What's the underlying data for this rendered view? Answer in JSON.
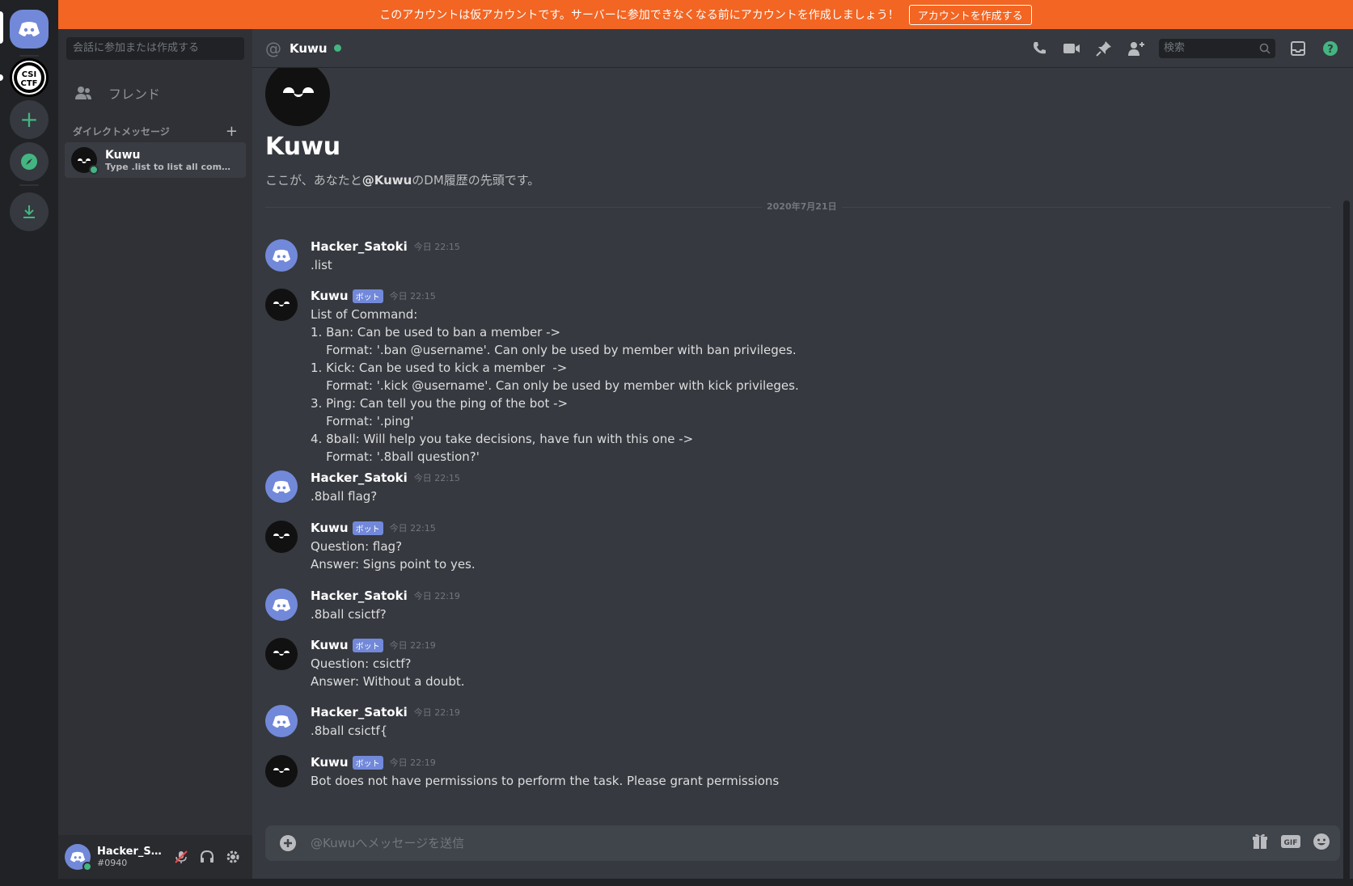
{
  "notice": {
    "text": "このアカウントは仮アカウントです。サーバーに参加できなくなる前にアカウントを作成しましょう！",
    "button": "アカウントを作成する"
  },
  "sidebar": {
    "search_placeholder": "会話に参加または作成する",
    "friends_label": "フレンド",
    "dm_header": "ダイレクトメッセージ",
    "dm_items": [
      {
        "name": "Kuwu",
        "sub": "Type .list to list all command..."
      }
    ],
    "user": {
      "name": "Hacker_Sat...",
      "tag": "#0940"
    }
  },
  "chat": {
    "channel_name": "Kuwu",
    "search_placeholder": "検索",
    "intro_title": "Kuwu",
    "intro_sub_pre": "ここが、あなたと",
    "intro_sub_mention": "@Kuwu",
    "intro_sub_post": "のDM履歴の先頭です。",
    "date_divider": "2020年7月21日",
    "input_placeholder": "@Kuwuへメッセージを送信",
    "bot_tag": "ボット",
    "messages": [
      {
        "author": "Hacker_Satoki",
        "time": "今日 22:15",
        "bot": false,
        "text": ".list"
      },
      {
        "author": "Kuwu",
        "time": "今日 22:15",
        "bot": true,
        "text": "List of Command:\n1. Ban: Can be used to ban a member ->\n    Format: '.ban @username'. Can only be used by member with ban privileges.\n1. Kick: Can be used to kick a member  ->\n    Format: '.kick @username'. Can only be used by member with kick privileges.\n3. Ping: Can tell you the ping of the bot ->\n    Format: '.ping'\n4. 8ball: Will help you take decisions, have fun with this one ->\n    Format: '.8ball question?'"
      },
      {
        "author": "Hacker_Satoki",
        "time": "今日 22:15",
        "bot": false,
        "text": ".8ball flag?"
      },
      {
        "author": "Kuwu",
        "time": "今日 22:15",
        "bot": true,
        "text": "Question: flag?\nAnswer: Signs point to yes."
      },
      {
        "author": "Hacker_Satoki",
        "time": "今日 22:19",
        "bot": false,
        "text": ".8ball csictf?"
      },
      {
        "author": "Kuwu",
        "time": "今日 22:19",
        "bot": true,
        "text": "Question: csictf?\nAnswer: Without a doubt."
      },
      {
        "author": "Hacker_Satoki",
        "time": "今日 22:19",
        "bot": false,
        "text": ".8ball csictf{"
      },
      {
        "author": "Kuwu",
        "time": "今日 22:19",
        "bot": true,
        "text": "Bot does not have permissions to perform the task. Please grant permissions"
      }
    ]
  },
  "rail": {
    "server_label": "CSI CTF"
  },
  "colors": {
    "notice": "#f26522",
    "blurple": "#7289da",
    "online": "#43b581"
  }
}
